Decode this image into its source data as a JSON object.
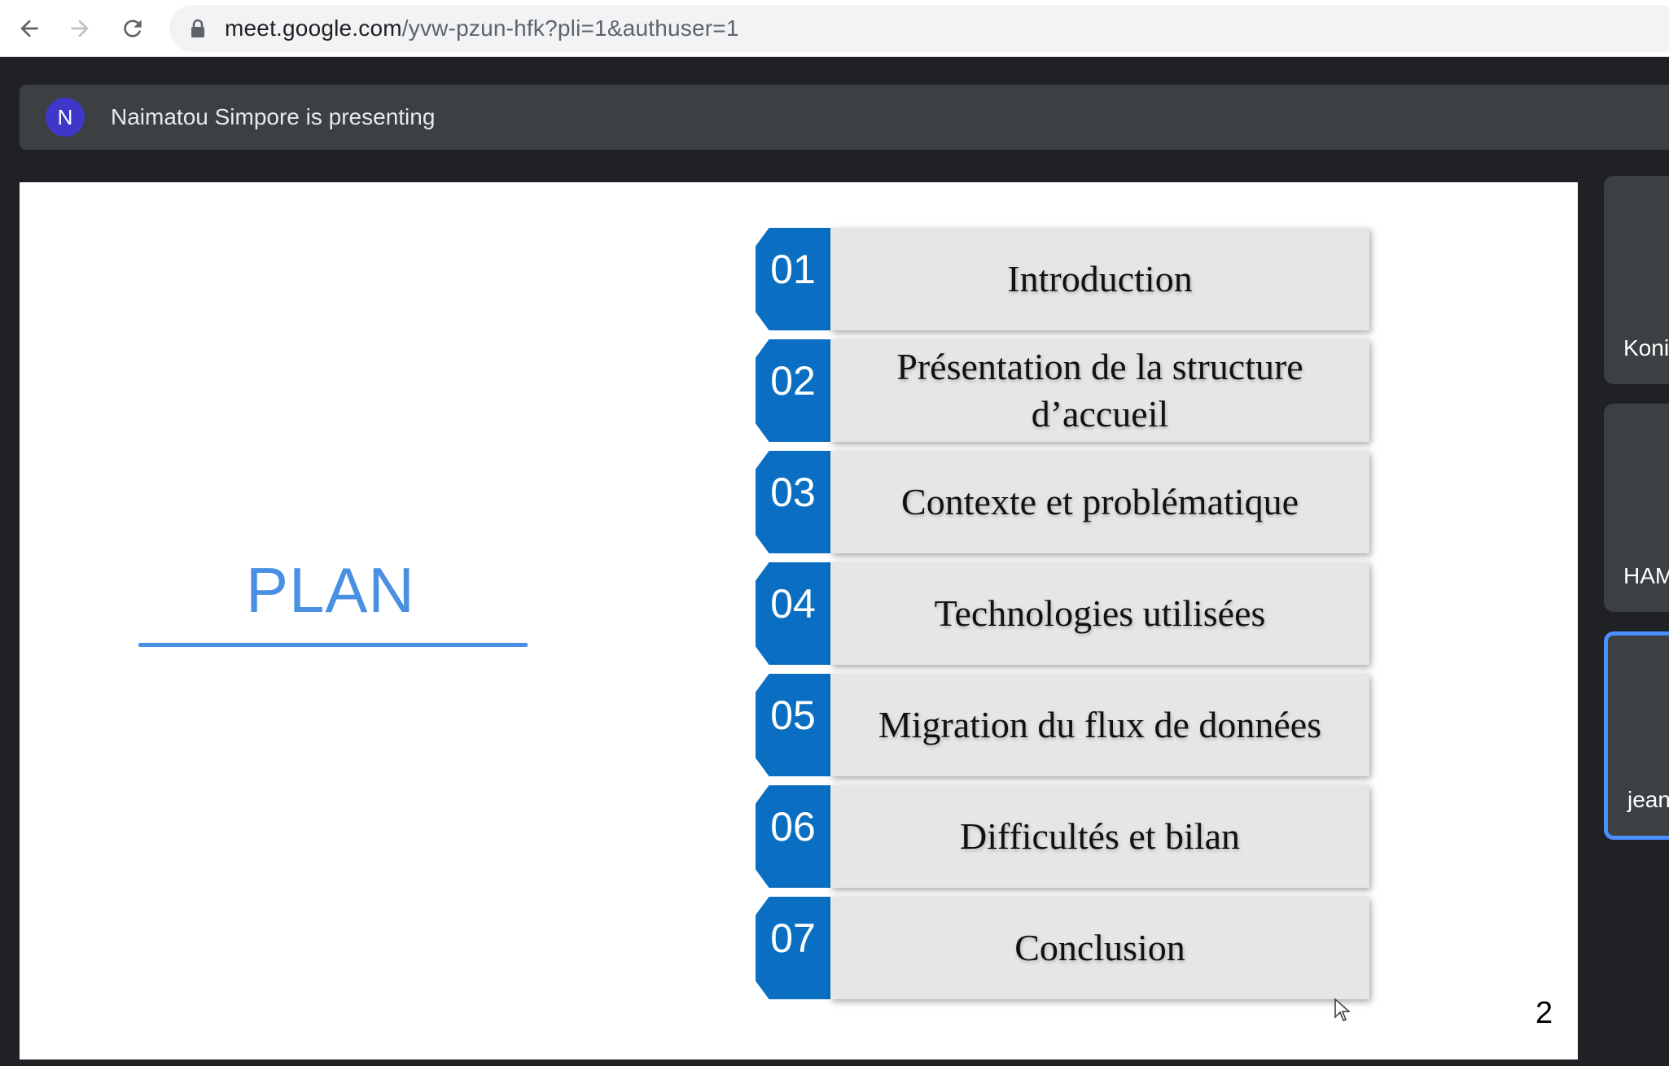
{
  "browser": {
    "url_host": "meet.google.com",
    "url_path": "/yvw-pzun-hfk?pli=1&authuser=1"
  },
  "presentation": {
    "avatar_letter": "N",
    "presenter_text": "Naimatou Simpore is presenting"
  },
  "slide": {
    "title": "PLAN",
    "page_number": "2",
    "items": [
      {
        "number": "01",
        "label": "Introduction"
      },
      {
        "number": "02",
        "label": "Présentation de la structure d’accueil"
      },
      {
        "number": "03",
        "label": "Contexte et problématique"
      },
      {
        "number": "04",
        "label": "Technologies utilisées"
      },
      {
        "number": "05",
        "label": "Migration du flux de données"
      },
      {
        "number": "06",
        "label": "Difficultés et bilan"
      },
      {
        "number": "07",
        "label": "Conclusion"
      }
    ]
  },
  "participants": [
    {
      "name": "Koni",
      "active": false
    },
    {
      "name": "HAM",
      "active": false
    },
    {
      "name": "jean",
      "active": true
    }
  ],
  "colors": {
    "accent_blue": "#0a6fc2",
    "plan_blue": "#4a90e2",
    "meet_background": "#202124"
  }
}
